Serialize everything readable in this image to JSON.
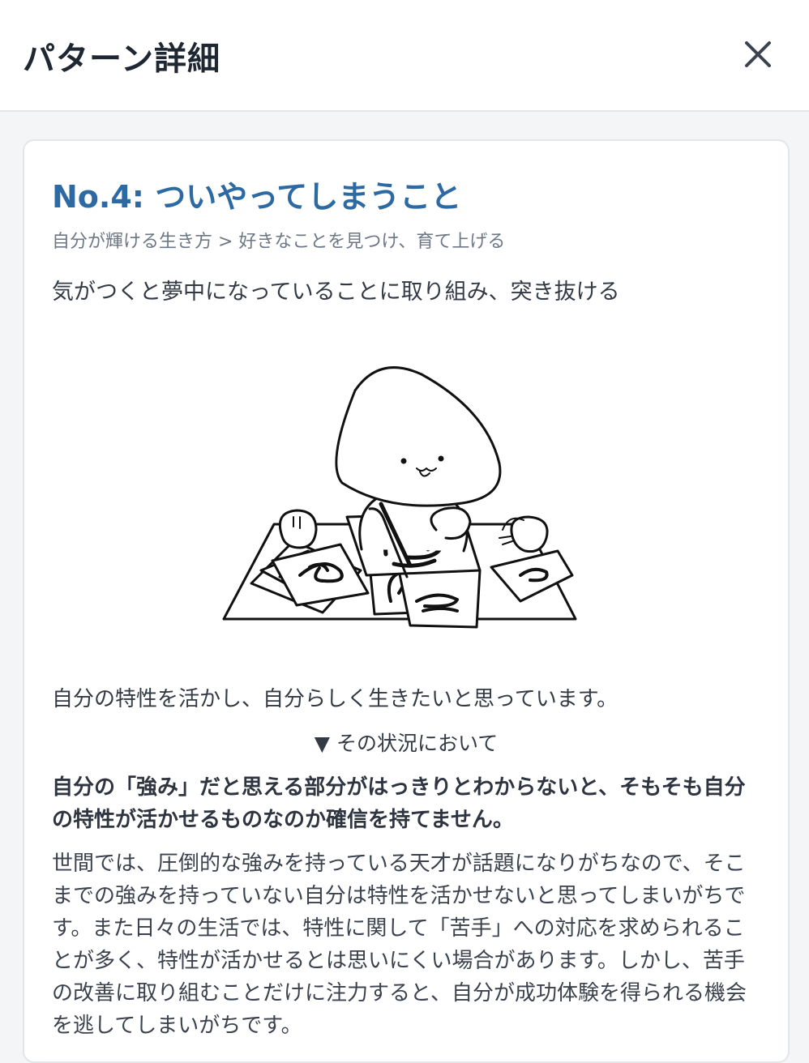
{
  "header": {
    "title": "パターン詳細",
    "close_icon": "close-icon"
  },
  "pattern": {
    "title": "No.4: ついやってしまうこと",
    "breadcrumb": "自分が輝ける生き方 > 好きなことを見つけ、育て上げる",
    "summary": "気がつくと夢中になっていることに取り組み、突き抜ける",
    "illustration": "character-drawing-illustration",
    "context": "自分の特性を活かし、自分らしく生きたいと思っています。",
    "divider_label": "▼ その状況において",
    "problem": "自分の「強み」だと思える部分がはっきりとわからないと、そもそも自分の特性が活かせるものなのか確信を持てません。",
    "body": "世間では、圧倒的な強みを持っている天才が話題になりがちなので、そこまでの強みを持っていない自分は特性を活かせないと思ってしまいがちです。また日々の生活では、特性に関して「苦手」への対応を求められることが多く、特性が活かせるとは思いにくい場合があります。しかし、苦手の改善に取り組むことだけに注力すると、自分が成功体験を得られる機会を逃してしまいがちです。"
  },
  "colors": {
    "title_accent": "#2d6aa3",
    "text": "#333a44",
    "muted": "#6d7786",
    "background": "#f4f5f7"
  }
}
